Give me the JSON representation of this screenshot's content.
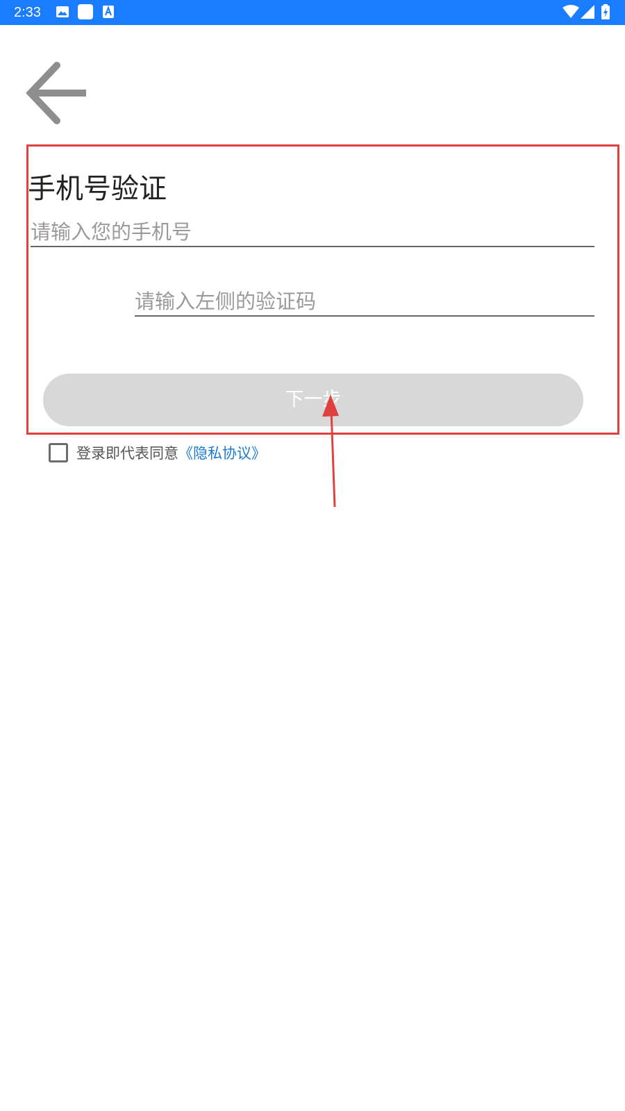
{
  "status_bar": {
    "time": "2:33",
    "icons": [
      "image-icon",
      "app-square-icon",
      "text-a-icon",
      "wifi-icon",
      "signal-icon",
      "battery-icon"
    ]
  },
  "header": {
    "back_icon": "arrow-left-icon"
  },
  "form": {
    "title": "手机号验证",
    "phone_placeholder": "请输入您的手机号",
    "captcha_placeholder": "请输入左侧的验证码",
    "next_label": "下一步"
  },
  "agreement": {
    "text": "登录即代表同意",
    "link_label": "《隐私协议》",
    "checked": false
  },
  "colors": {
    "status_bar": "#1a7cff",
    "button_disabled": "#d8d8d8",
    "link": "#1a7ad0",
    "annotation": "#e04040"
  }
}
